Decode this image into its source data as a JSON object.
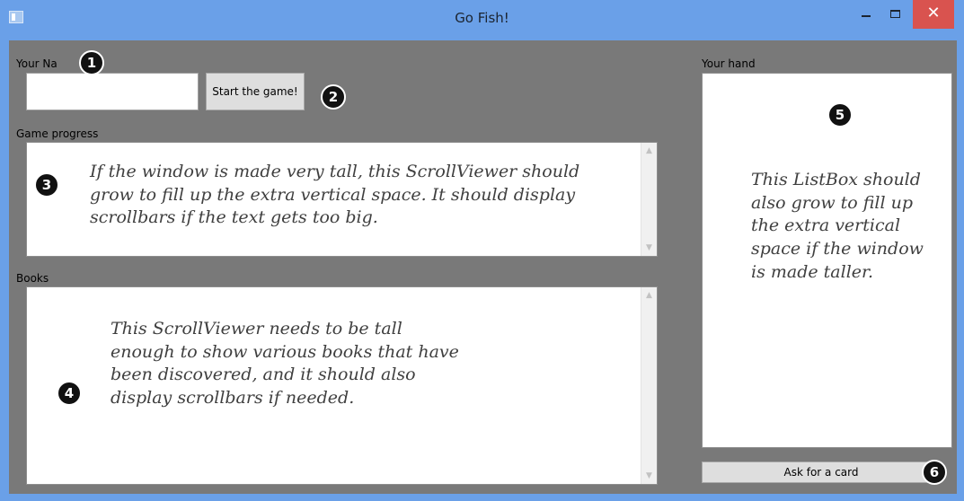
{
  "window": {
    "title": "Go Fish!",
    "minimize_icon": "minimize-icon",
    "maximize_icon": "maximize-icon",
    "close_glyph": "✕"
  },
  "form": {
    "name_label": "Your Na",
    "name_value": "",
    "start_button": "Start the game!",
    "progress_label": "Game progress",
    "books_label": "Books",
    "hand_label": "Your hand",
    "ask_button": "Ask for a card"
  },
  "notes": {
    "progress": "If the window is made very tall, this ScrollViewer should grow to fill up the extra vertical space. It should display scrollbars if the text gets too big.",
    "books": "This ScrollViewer needs to be tall enough to show various books that have been discovered, and it should also display scrollbars if needed.",
    "hand": "This ListBox should also grow to fill up the extra vertical space if the window is made taller."
  },
  "badges": [
    "1",
    "2",
    "3",
    "4",
    "5",
    "6"
  ],
  "colors": {
    "title_bar": "#6aa0e8",
    "client_bg": "#797979",
    "close_button": "#d9534f"
  }
}
